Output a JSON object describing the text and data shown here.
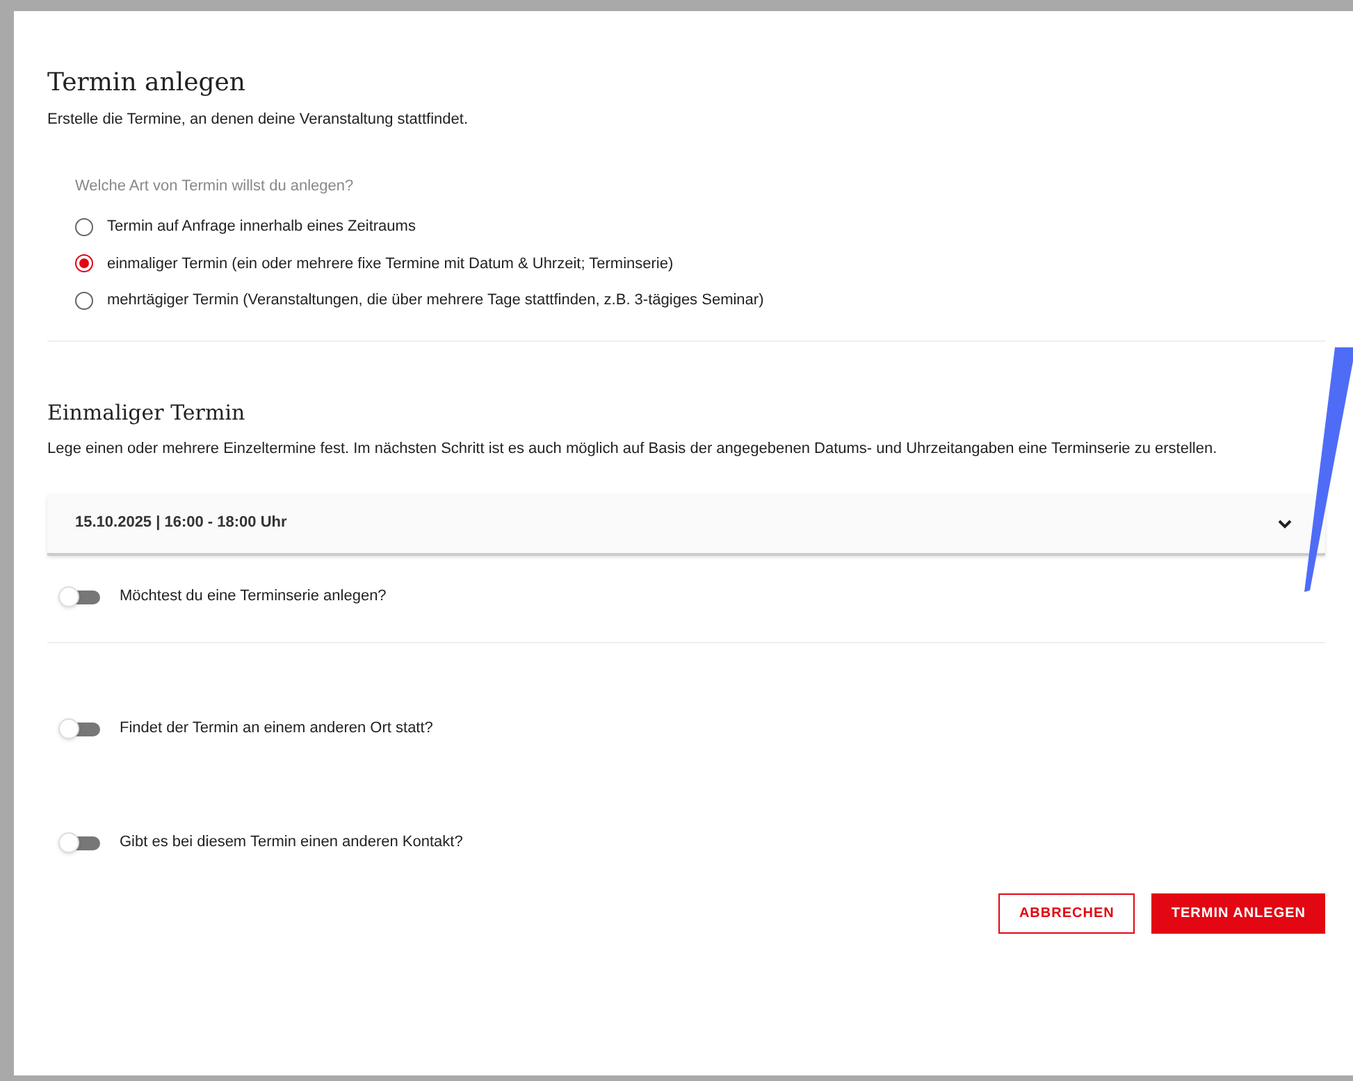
{
  "header": {
    "title": "Termin anlegen",
    "subtitle": "Erstelle die Termine, an denen deine Veranstaltung stattfindet."
  },
  "type_question": {
    "label": "Welche Art von Termin willst du anlegen?",
    "options": [
      {
        "label": "Termin auf Anfrage innerhalb eines Zeitraums",
        "selected": false
      },
      {
        "label": "einmaliger Termin (ein oder mehrere fixe Termine mit Datum & Uhrzeit; Terminserie)",
        "selected": true
      },
      {
        "label": "mehrtägiger Termin (Veranstaltungen, die über mehrere Tage stattfinden, z.B. 3-tägiges Seminar)",
        "selected": false
      }
    ]
  },
  "section": {
    "title": "Einmaliger Termin",
    "description": "Lege einen oder mehrere Einzeltermine fest. Im nächsten Schritt ist es auch möglich auf Basis der angegebenen Datums- und Uhrzeitangaben eine Terminserie zu erstellen.",
    "dates": [
      {
        "label": "15.10.2025 | 16:00 - 18:00 Uhr",
        "expanded": false
      }
    ]
  },
  "toggles": [
    {
      "label": "Möchtest du eine Terminserie anlegen?",
      "on": false
    },
    {
      "label": "Findet der Termin an einem anderen Ort statt?",
      "on": false
    },
    {
      "label": "Gibt es bei diesem Termin einen anderen Kontakt?",
      "on": false
    }
  ],
  "buttons": [
    {
      "label": "ABBRECHEN",
      "kind": "secondary"
    },
    {
      "label": "TERMIN ANLEGEN",
      "kind": "primary"
    }
  ]
}
